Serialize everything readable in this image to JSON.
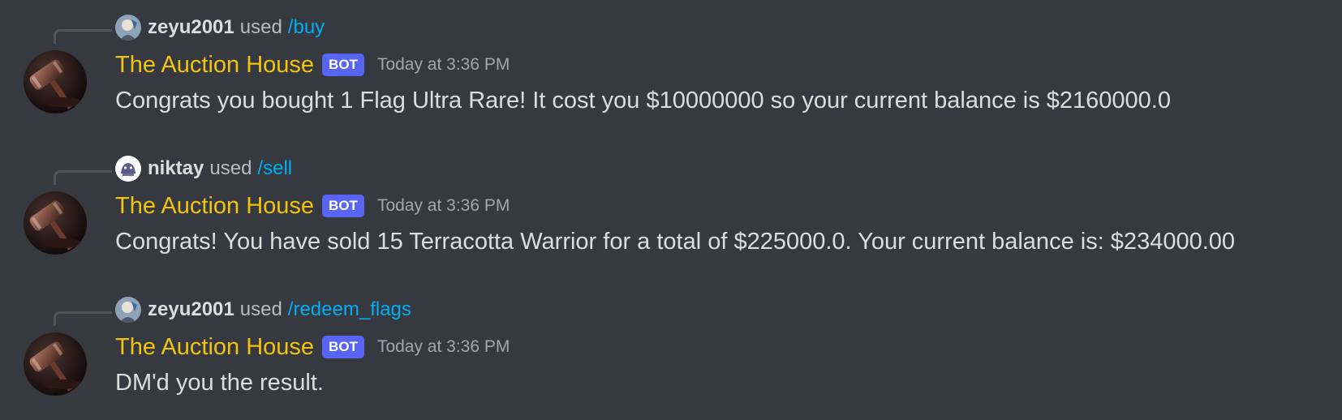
{
  "colors": {
    "background": "#36393f",
    "author": "#f1c40f",
    "bot_badge": "#5865f2",
    "command_link": "#00aff4",
    "text": "#dcddde",
    "muted": "#a3a6aa"
  },
  "messages": [
    {
      "reply": {
        "user": "zeyu2001",
        "used": "used",
        "command": "/buy",
        "avatar_icon": "user-avatar-icon"
      },
      "author": "The Auction House",
      "badge": "BOT",
      "timestamp": "Today at 3:36 PM",
      "content": "Congrats you bought 1 Flag Ultra Rare! It cost you $10000000 so your current balance is $2160000.0"
    },
    {
      "reply": {
        "user": "niktay",
        "used": "used",
        "command": "/sell",
        "avatar_icon": "user-avatar-icon"
      },
      "author": "The Auction House",
      "badge": "BOT",
      "timestamp": "Today at 3:36 PM",
      "content": "Congrats! You have sold 15 Terracotta Warrior for a total of $225000.0. Your current balance is: $234000.00"
    },
    {
      "reply": {
        "user": "zeyu2001",
        "used": "used",
        "command": "/redeem_flags",
        "avatar_icon": "user-avatar-icon"
      },
      "author": "The Auction House",
      "badge": "BOT",
      "timestamp": "Today at 3:36 PM",
      "content": "DM'd you the result."
    }
  ]
}
